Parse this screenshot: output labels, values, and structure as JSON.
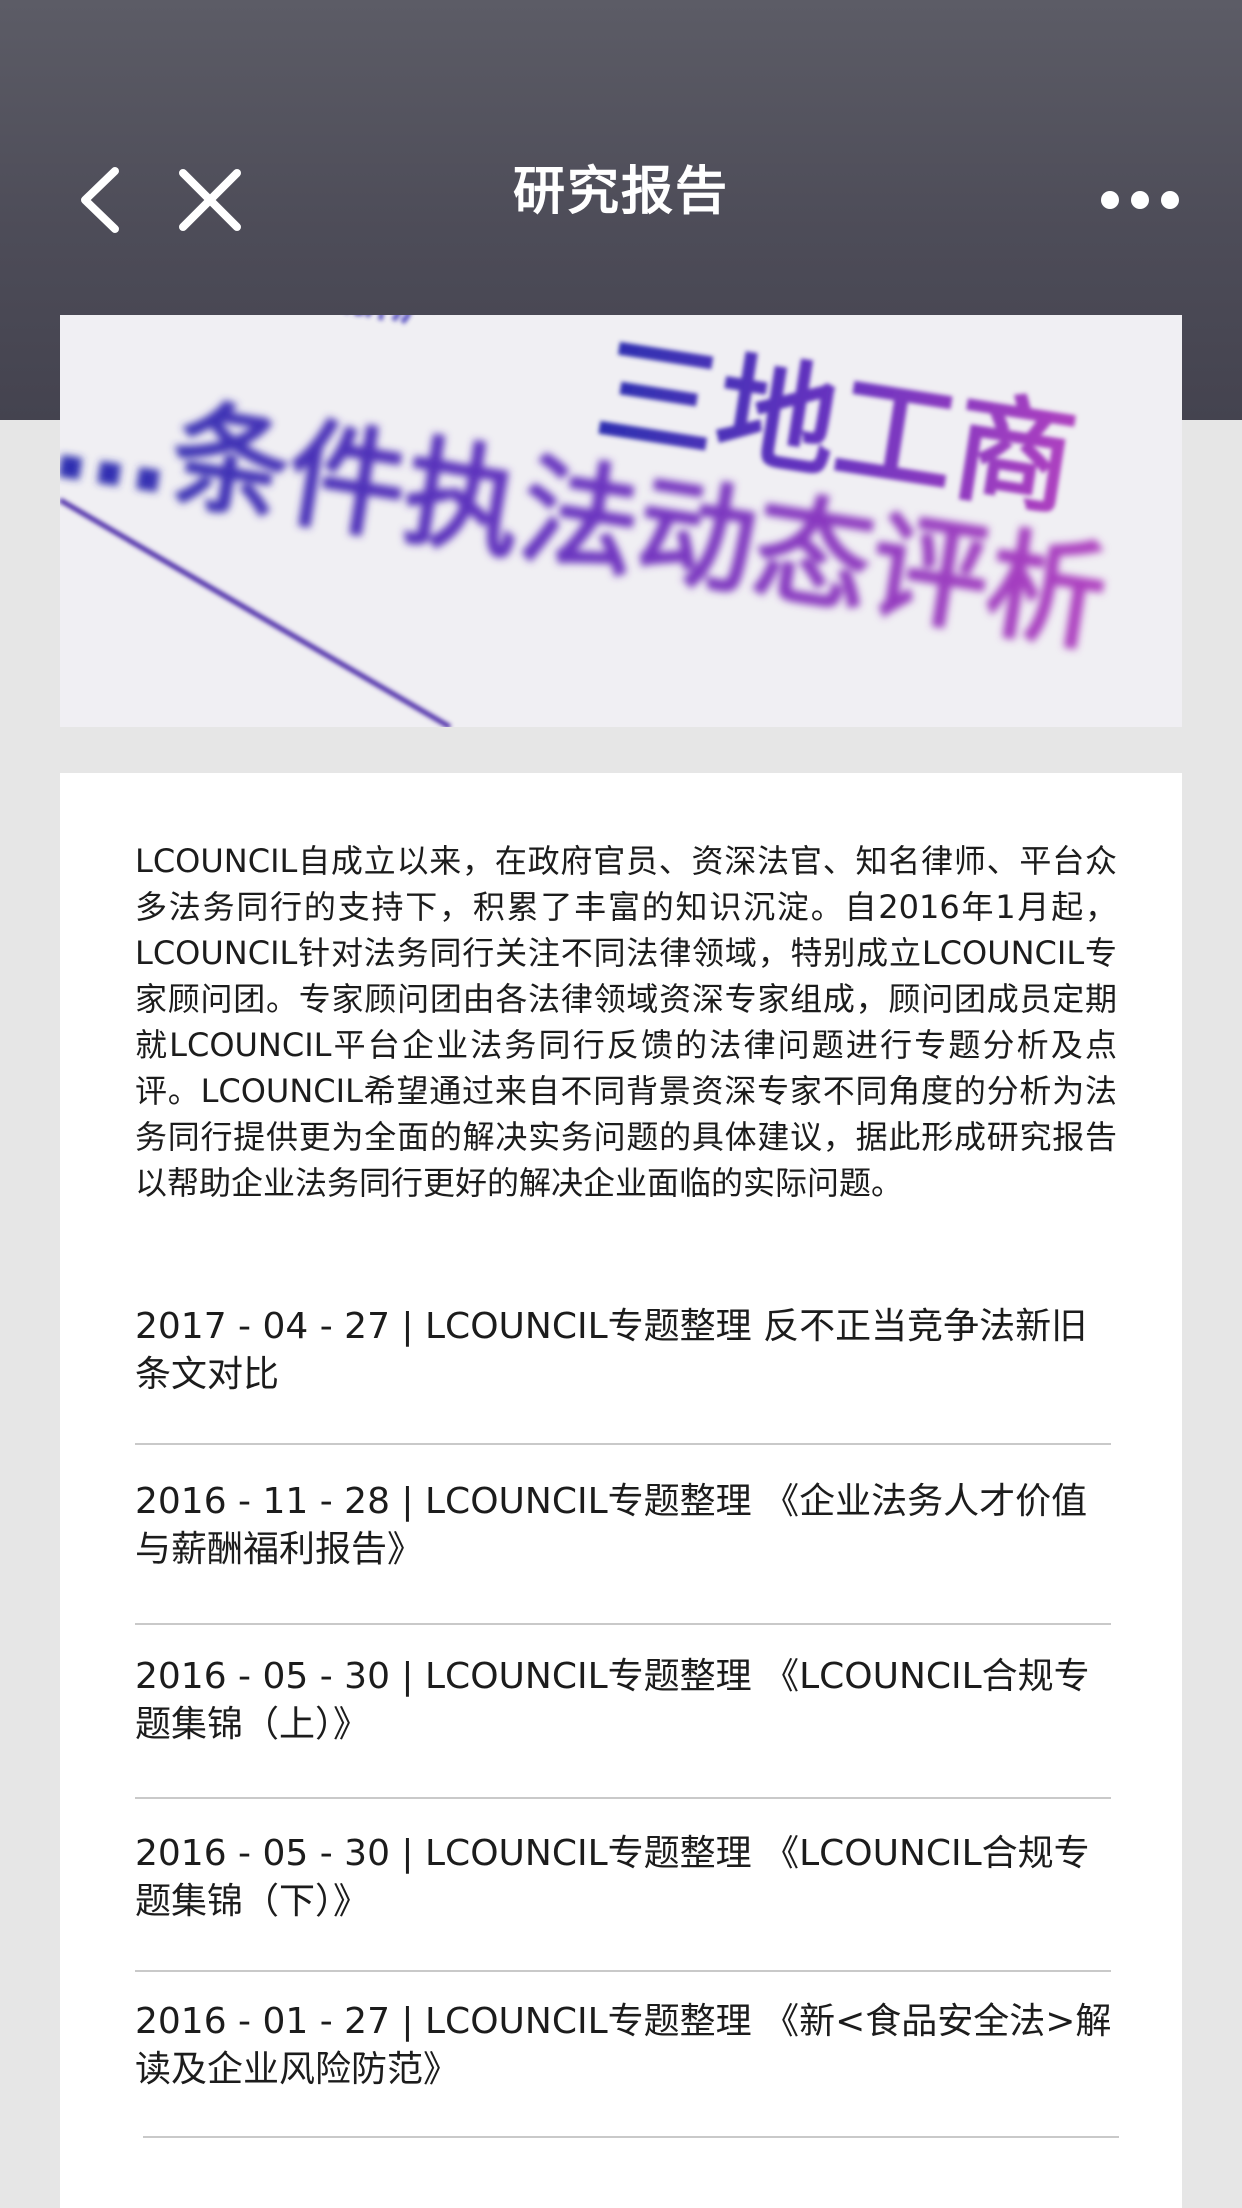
{
  "header": {
    "title": "研究报告",
    "back_icon": "chevron-left-icon",
    "close_icon": "close-icon",
    "more_icon": "more-dots-icon"
  },
  "banner": {
    "lines": [
      "\"江浙沪\"",
      "三地工商",
      "…条件执法动态评析"
    ]
  },
  "intro": {
    "text": "LCOUNCIL自成立以来，在政府官员、资深法官、知名律师、平台众多法务同行的支持下，积累了丰富的知识沉淀。自2016年1月起，LCOUNCIL针对法务同行关注不同法律领域，特别成立LCOUNCIL专家顾问团。专家顾问团由各法律领域资深专家组成，顾问团成员定期就LCOUNCIL平台企业法务同行反馈的法律问题进行专题分析及点评。LCOUNCIL希望通过来自不同背景资深专家不同角度的分析为法务同行提供更为全面的解决实务问题的具体建议，据此形成研究报告以帮助企业法务同行更好的解决企业面临的实际问题。"
  },
  "reports": [
    {
      "text": "2017 - 04 - 27 | LCOUNCIL专题整理 反不正当竞争法新旧条文对比"
    },
    {
      "text": "2016 - 11 - 28 | LCOUNCIL专题整理 《企业法务人才价值与薪酬福利报告》"
    },
    {
      "text": "2016 - 05 - 30 | LCOUNCIL专题整理 《LCOUNCIL合规专题集锦（上）》"
    },
    {
      "text": "2016 - 05 - 30 | LCOUNCIL专题整理 《LCOUNCIL合规专题集锦（下）》"
    },
    {
      "text": "2016 - 01 - 27 | LCOUNCIL专题整理 《新<食品安全法>解读及企业风险防范》"
    }
  ],
  "colors": {
    "header_bg": "#4d4c58",
    "page_bg": "#e6e6e6",
    "banner_text_primary": "#3a2fb8",
    "banner_text_secondary": "#b040c0"
  }
}
